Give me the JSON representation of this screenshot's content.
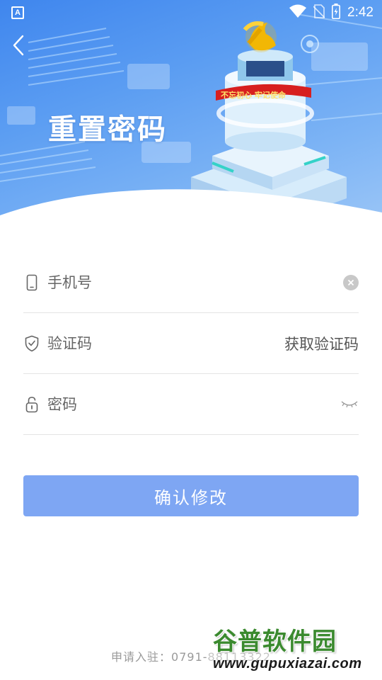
{
  "status_bar": {
    "app_icon_label": "A",
    "time": "2:42",
    "icons": [
      "wifi-icon",
      "no-sim-icon",
      "battery-charging-icon"
    ]
  },
  "header": {
    "title": "重置密码",
    "back_icon": "chevron-left-icon"
  },
  "banner": {
    "slogan": "不忘初心 牢记使命",
    "icon": "party-emblem"
  },
  "form": {
    "phone": {
      "placeholder": "手机号",
      "icon": "phone-icon",
      "clear_icon": "clear-icon"
    },
    "code": {
      "placeholder": "验证码",
      "icon": "shield-check-icon",
      "action_label": "获取验证码"
    },
    "password": {
      "placeholder": "密码",
      "icon": "lock-icon",
      "toggle_icon": "eye-closed-icon"
    }
  },
  "submit_label": "确认修改",
  "footer_text": "申请入驻：0791-88113322",
  "watermark": {
    "title": "谷普软件园",
    "url": "www.gupuxiazai.com"
  },
  "colors": {
    "primary": "#7ea6f3",
    "hero_top": "#3f86ee",
    "hero_bottom": "#9fc8f7",
    "emblem": "#f2b705",
    "slogan_bg": "#d71f1f"
  }
}
